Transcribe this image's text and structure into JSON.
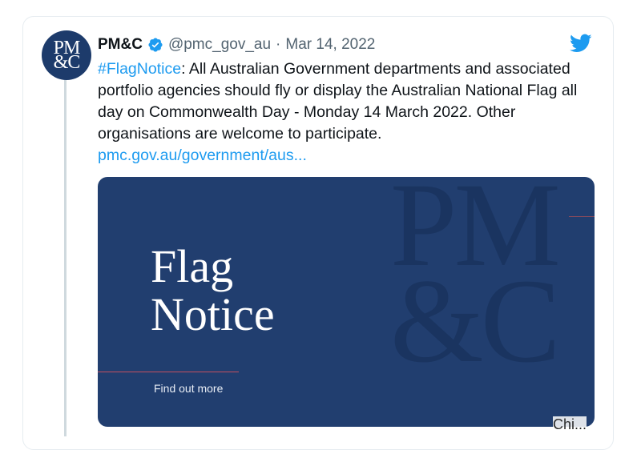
{
  "tweet": {
    "avatar_text": "PM\n&C",
    "author_name": "PM&C",
    "handle": "@pmc_gov_au",
    "separator": "·",
    "date": "Mar 14, 2022",
    "hashtag": "#FlagNotice",
    "body": ": All Australian Government departments and associated portfolio agencies should fly or display the Australian National Flag all day on Commonwealth Day - Monday 14 March 2022. Other organisations are welcome to participate.",
    "link": "pmc.gov.au/government/aus...",
    "verified_icon": "verified-badge-icon",
    "platform_icon": "twitter-bird-icon"
  },
  "media": {
    "title": "Flag\nNotice",
    "cta": "Find out more",
    "watermark": "PM\n&C"
  },
  "colors": {
    "link": "#1d9bf0",
    "media_bg": "#213e6f",
    "accent_line": "#c3505f"
  },
  "watermark_text": "Chi..."
}
